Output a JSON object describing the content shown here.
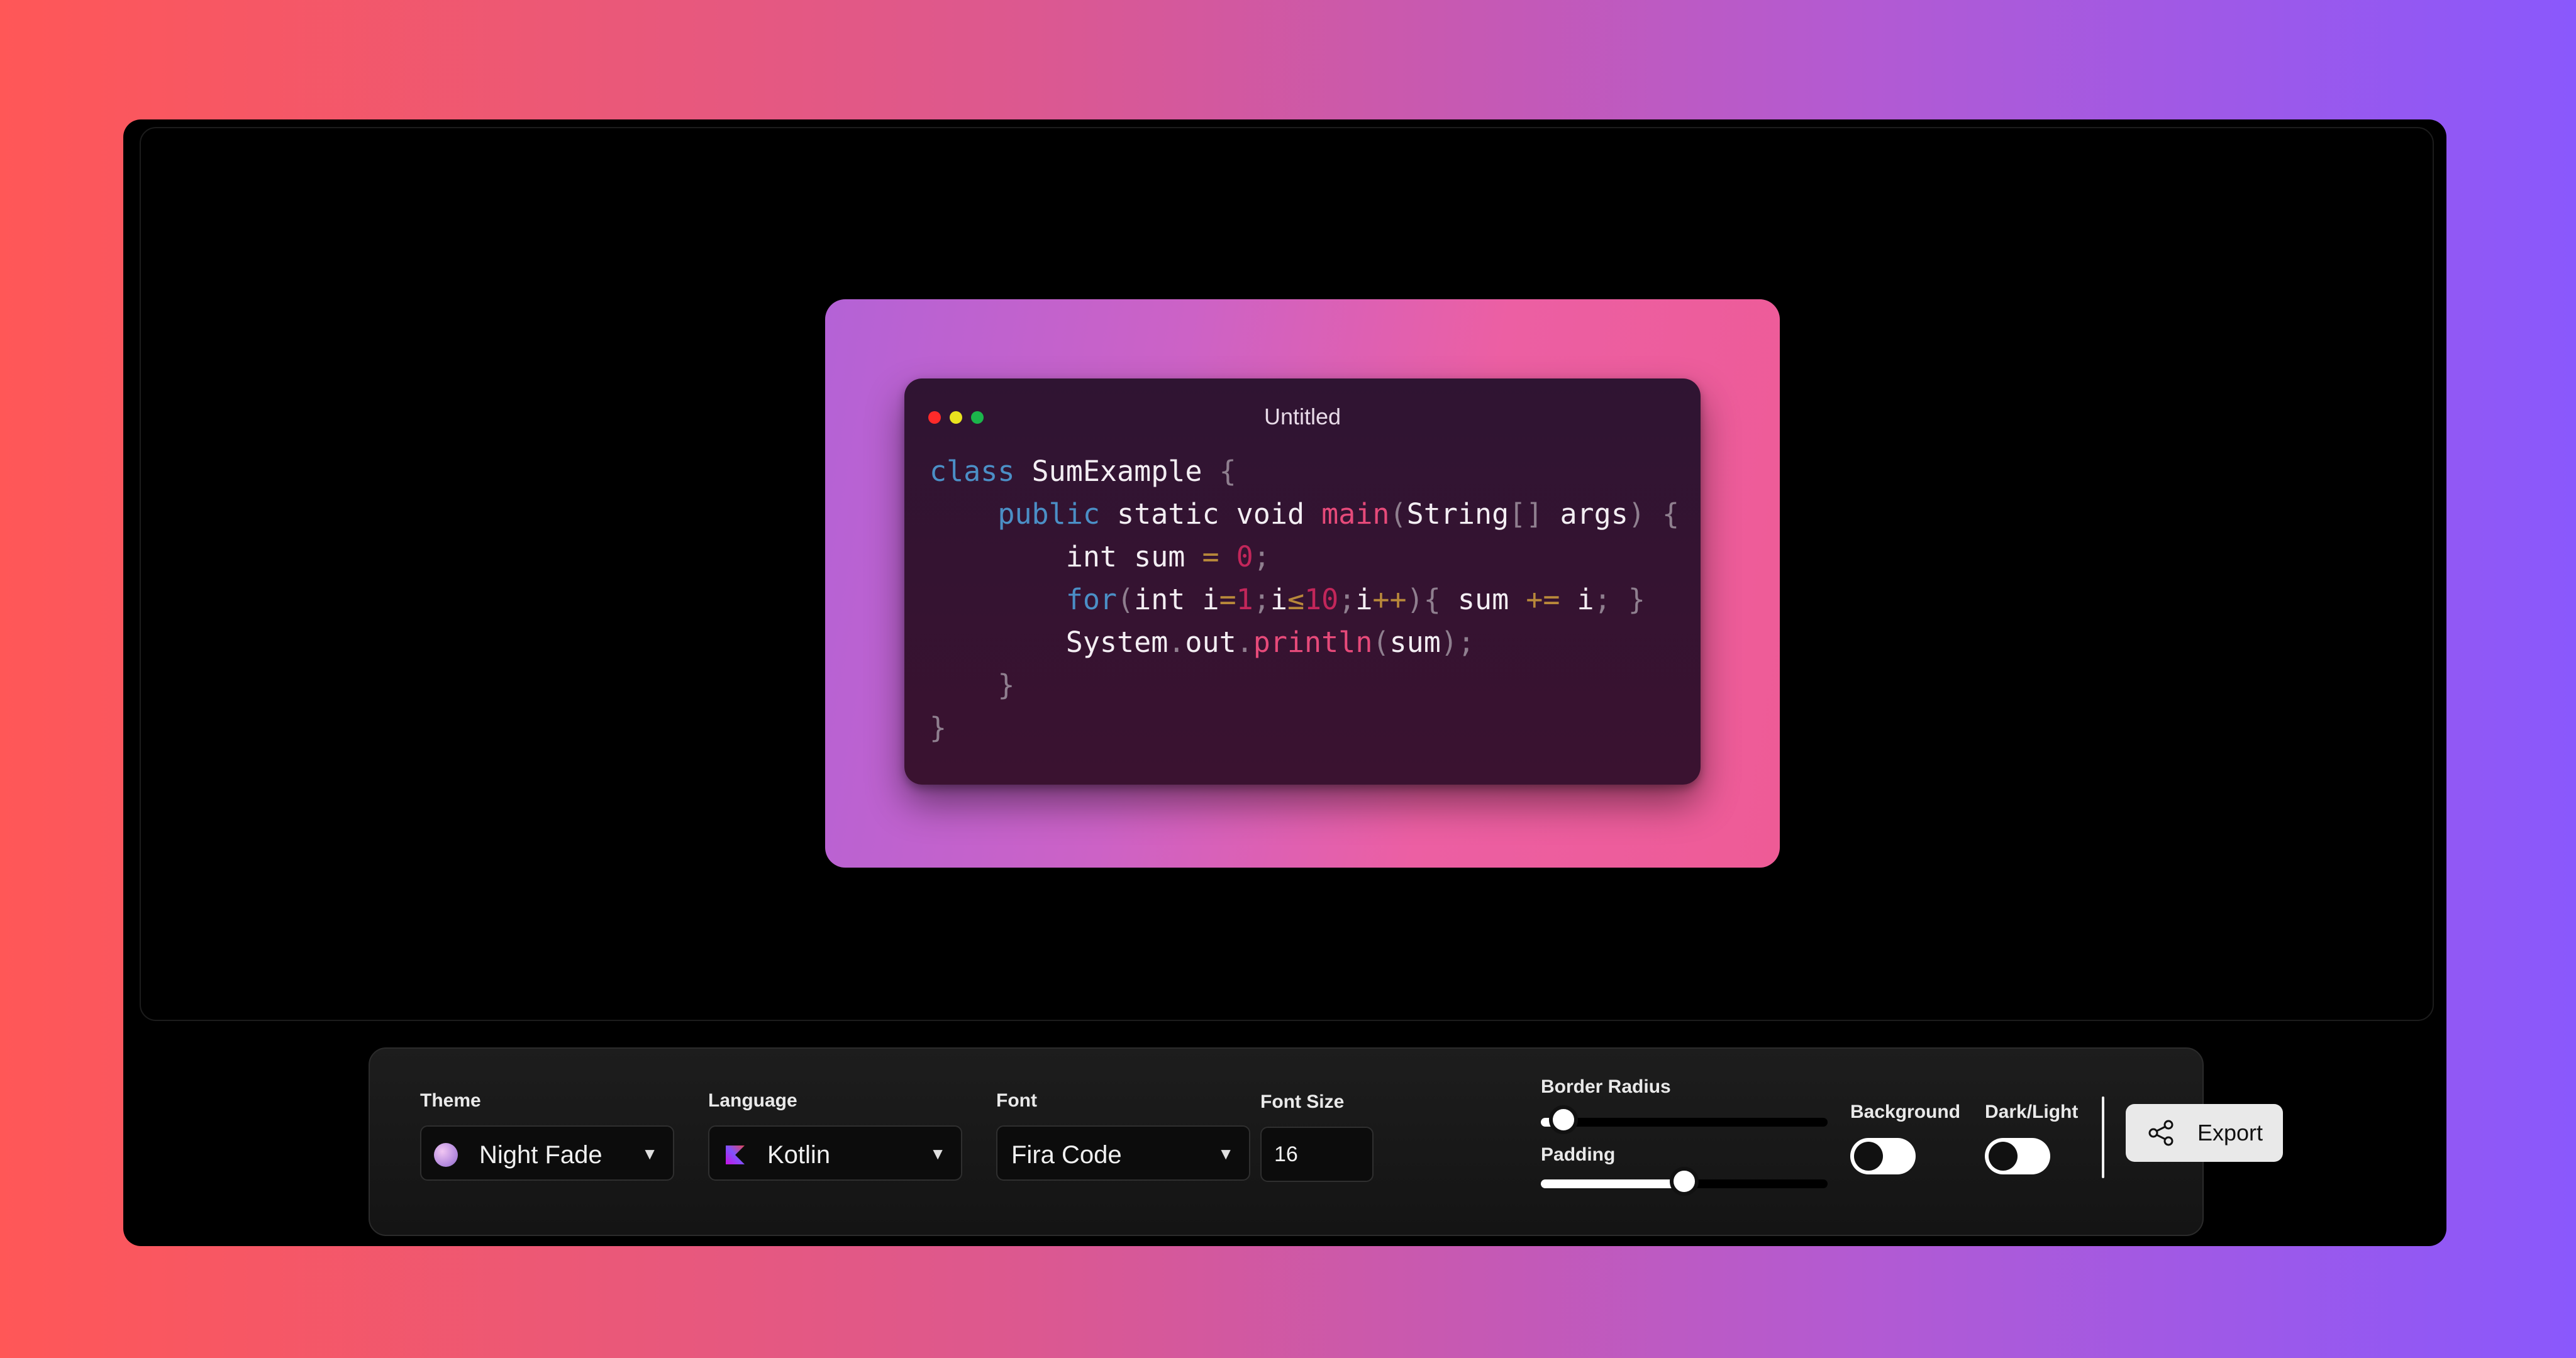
{
  "code_window": {
    "title": "Untitled",
    "lines": [
      [
        {
          "t": "class",
          "c": "kw"
        },
        {
          "t": " SumExample ",
          "c": "id"
        },
        {
          "t": "{",
          "c": "pn"
        }
      ],
      [
        {
          "t": "    public",
          "c": "kw"
        },
        {
          "t": " static void ",
          "c": "id"
        },
        {
          "t": "main",
          "c": "fn"
        },
        {
          "t": "(",
          "c": "pn"
        },
        {
          "t": "String",
          "c": "id"
        },
        {
          "t": "[]",
          "c": "pn"
        },
        {
          "t": " args",
          "c": "id"
        },
        {
          "t": ") {",
          "c": "pn"
        }
      ],
      [
        {
          "t": "        int sum ",
          "c": "id"
        },
        {
          "t": "=",
          "c": "op"
        },
        {
          "t": " ",
          "c": "id"
        },
        {
          "t": "0",
          "c": "num"
        },
        {
          "t": ";",
          "c": "pn"
        }
      ],
      [
        {
          "t": "        for",
          "c": "kw"
        },
        {
          "t": "(",
          "c": "pn"
        },
        {
          "t": "int i",
          "c": "id"
        },
        {
          "t": "=",
          "c": "op"
        },
        {
          "t": "1",
          "c": "num"
        },
        {
          "t": ";",
          "c": "pn"
        },
        {
          "t": "i",
          "c": "id"
        },
        {
          "t": "≤",
          "c": "op"
        },
        {
          "t": "10",
          "c": "num"
        },
        {
          "t": ";",
          "c": "pn"
        },
        {
          "t": "i",
          "c": "id"
        },
        {
          "t": "++",
          "c": "op"
        },
        {
          "t": "){ ",
          "c": "pn"
        },
        {
          "t": "sum ",
          "c": "id"
        },
        {
          "t": "+=",
          "c": "op"
        },
        {
          "t": " i",
          "c": "id"
        },
        {
          "t": "; }",
          "c": "pn"
        }
      ],
      [
        {
          "t": "        System",
          "c": "id"
        },
        {
          "t": ".",
          "c": "pn"
        },
        {
          "t": "out",
          "c": "id"
        },
        {
          "t": ".",
          "c": "pn"
        },
        {
          "t": "println",
          "c": "fn"
        },
        {
          "t": "(",
          "c": "pn"
        },
        {
          "t": "sum",
          "c": "id"
        },
        {
          "t": ");",
          "c": "pn"
        }
      ],
      [
        {
          "t": "    }",
          "c": "pn"
        }
      ],
      [
        {
          "t": "}",
          "c": "pn"
        }
      ]
    ]
  },
  "toolbar": {
    "theme": {
      "label": "Theme",
      "value": "Night Fade"
    },
    "language": {
      "label": "Language",
      "value": "Kotlin"
    },
    "font": {
      "label": "Font",
      "value": "Fira Code"
    },
    "font_size": {
      "label": "Font Size",
      "value": "16"
    },
    "border_radius": {
      "label": "Border Radius",
      "level": 0.08
    },
    "padding": {
      "label": "Padding",
      "level": 0.5
    },
    "background": {
      "label": "Background",
      "on": false
    },
    "dark_light": {
      "label": "Dark/Light",
      "on": false
    },
    "export_label": "Export"
  },
  "colors": {
    "page_gradient": [
      "#ff5757",
      "#8a58fc"
    ],
    "frame_gradient": [
      "#b462d6",
      "#ee5b96"
    ],
    "window_bg": "#2f1432"
  }
}
